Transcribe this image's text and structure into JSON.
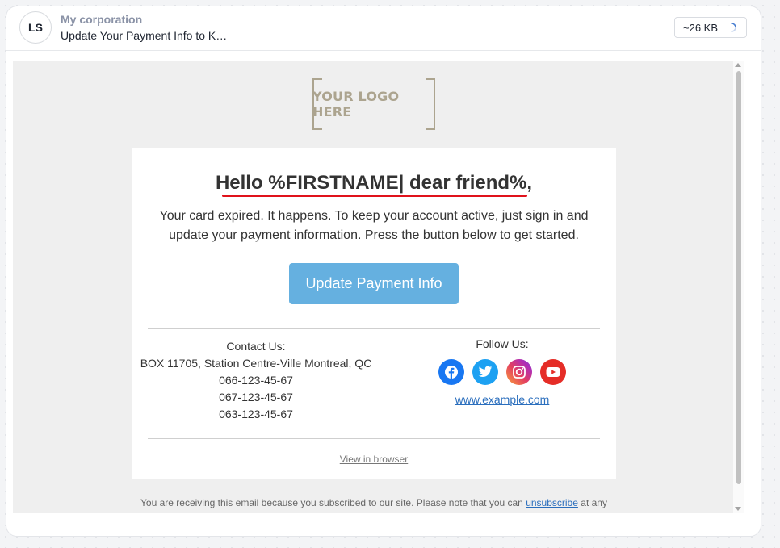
{
  "header": {
    "avatar_initials": "LS",
    "sender": "My corporation",
    "subject": "Update Your Payment Info to K…",
    "size": "~26 KB"
  },
  "email": {
    "logo_text": "YOUR LOGO HERE",
    "greeting": "Hello %FIRSTNAME| dear friend%,",
    "intro": "Your card expired. It happens. To keep your account active, just sign in and update your payment information. Press the button below to get started.",
    "cta_label": "Update Payment Info",
    "contact": {
      "heading": "Contact Us:",
      "address": "BOX 11705, Station Centre-Ville Montreal, QC",
      "phones": [
        "066-123-45-67",
        "067-123-45-67",
        "063-123-45-67"
      ]
    },
    "follow": {
      "heading": "Follow Us:",
      "networks": [
        "facebook-icon",
        "twitter-icon",
        "instagram-icon",
        "youtube-icon"
      ],
      "website": "www.example.com"
    },
    "view_in_browser": "View in browser",
    "footer_before": "You are receiving this email because you subscribed to our site. Please note that you can",
    "footer_link": "unsubscribe",
    "footer_after": "at any"
  },
  "colors": {
    "cta": "#65b0e0",
    "underline": "#e0121b",
    "facebook": "#1877f2",
    "twitter": "#1da1f2",
    "youtube": "#e52d27"
  }
}
